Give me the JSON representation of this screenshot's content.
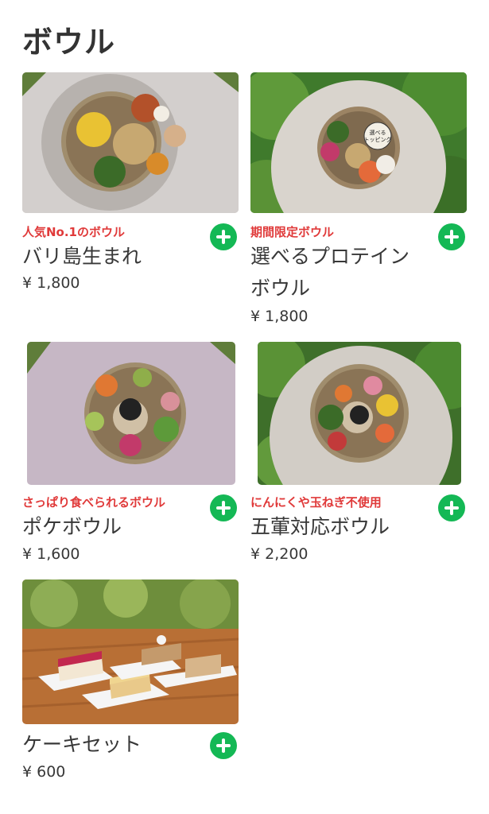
{
  "section": {
    "title": "ボウル"
  },
  "items": [
    {
      "tag": "人気No.1のボウル",
      "name": "バリ島生まれ",
      "price": "¥ 1,800",
      "image": "bali-bowl-photo"
    },
    {
      "tag": "期間限定ボウル",
      "name_line1": "選べるプロテイン",
      "name_line2": "ボウル",
      "price": "¥ 1,800",
      "image": "protein-bowl-photo",
      "image_label": "選べる\nトッピング"
    },
    {
      "tag": "さっぱり食べられるボウル",
      "name": "ポケボウル",
      "price": "¥ 1,600",
      "image": "poke-bowl-photo"
    },
    {
      "tag": "にんにくや玉ねぎ不使用",
      "name": "五葷対応ボウル",
      "price": "¥ 2,200",
      "image": "gokun-bowl-photo"
    },
    {
      "tag": "",
      "name": "ケーキセット",
      "price": "¥ 600",
      "image": "cake-set-photo"
    }
  ],
  "colors": {
    "accent": "#14b855",
    "tag": "#e03a3a"
  },
  "icons": {
    "add": "plus-circle-icon"
  }
}
